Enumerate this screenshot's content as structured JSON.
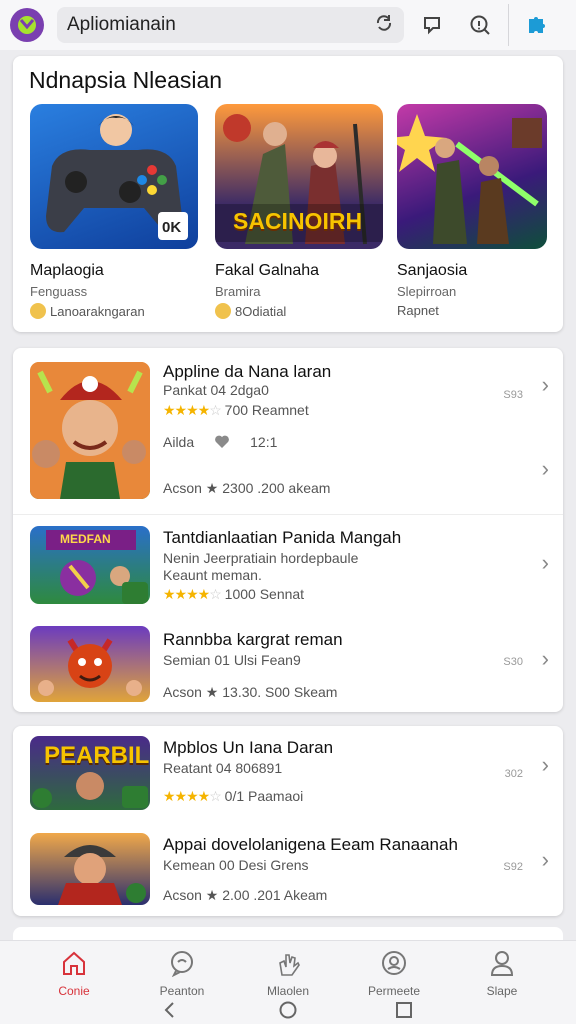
{
  "search": {
    "value": "Apliomianain"
  },
  "featured": {
    "title": "Ndnapsia Nleasian",
    "items": [
      {
        "name": "Maplaogia",
        "sub": "Fenguass",
        "meta": "Lanoarakngaran",
        "badge": "0K"
      },
      {
        "name": "Fakal Galnaha",
        "sub": "Bramira",
        "meta": "8Odiatial",
        "banner": "SACINOIRH"
      },
      {
        "name": "Sanjaosia",
        "sub": "Slepirroan",
        "meta": "Rapnet"
      }
    ]
  },
  "list1": [
    {
      "title": "Appline da Nana laran",
      "sub": "Pankat 04 2dga0",
      "rating_text": "700 Reamnet",
      "extra_a": "Ailda",
      "extra_b": "12:1",
      "foot": "Acson ★ 2300 .200 akeam",
      "num": "S93"
    },
    {
      "title": "Tantdianlaatian Panida Mangah",
      "sub": "Nenin Jeerpratiain hordepbaule",
      "sub2": "Keaunt meman.",
      "rating_text": "1000 Sennat",
      "banner": "MEDFAN"
    },
    {
      "title": "Rannbba kargrat reman",
      "sub": "Semian 01 Ulsi Fean9",
      "foot": "Acson ★ 13.30. S00 Skeam",
      "num": "S30"
    }
  ],
  "list2": [
    {
      "title": "Mpblos Un Iana Daran",
      "sub": "Reatant 04 806891",
      "rating_text": "0/1 Paamaoi",
      "num": "302",
      "banner": "PEARBIL"
    },
    {
      "title": "Appai dovelolanigena Eeam Ranaanah",
      "sub": "Kemean 00 Desi Grens",
      "foot": "Acson ★ 2.00 .201 Akeam",
      "num": "S92"
    }
  ],
  "nav": [
    {
      "label": "Conie",
      "icon": "home-icon",
      "active": true
    },
    {
      "label": "Peanton",
      "icon": "chat-icon"
    },
    {
      "label": "Mlaolen",
      "icon": "hand-icon"
    },
    {
      "label": "Permeete",
      "icon": "badge-icon"
    },
    {
      "label": "Slape",
      "icon": "profile-icon"
    }
  ],
  "colors": {
    "accent": "#d8333b",
    "star": "#f5b400",
    "logo": "#7a3fb0"
  }
}
